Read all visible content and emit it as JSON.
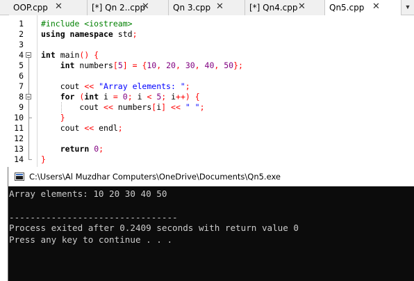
{
  "tabs": [
    {
      "label": "OOP.cpp",
      "active": false
    },
    {
      "label": "[*] Qn 2..cpp",
      "active": false
    },
    {
      "label": "Qn 3.cpp",
      "active": false
    },
    {
      "label": "[*] Qn4.cpp",
      "active": false
    },
    {
      "label": "Qn5.cpp",
      "active": true
    }
  ],
  "tab_close_glyph": "✕",
  "tab_scroll_glyph": "▼",
  "editor": {
    "line_numbers": [
      "1",
      "2",
      "3",
      "4",
      "5",
      "6",
      "7",
      "8",
      "9",
      "10",
      "11",
      "12",
      "13",
      "14"
    ],
    "lines": [
      [
        {
          "t": "#include <iostream>",
          "c": "pp"
        }
      ],
      [
        {
          "t": "using namespace",
          "c": "kw"
        },
        {
          "t": " std",
          "c": "plain"
        },
        {
          "t": ";",
          "c": "sym"
        }
      ],
      [],
      [
        {
          "t": "int",
          "c": "kw"
        },
        {
          "t": " main",
          "c": "plain"
        },
        {
          "t": "() {",
          "c": "sym"
        }
      ],
      [
        {
          "t": "    "
        },
        {
          "t": "int",
          "c": "kw"
        },
        {
          "t": " numbers",
          "c": "plain"
        },
        {
          "t": "[",
          "c": "sym"
        },
        {
          "t": "5",
          "c": "num"
        },
        {
          "t": "] = {",
          "c": "sym"
        },
        {
          "t": "10",
          "c": "num"
        },
        {
          "t": ", ",
          "c": "sym"
        },
        {
          "t": "20",
          "c": "num"
        },
        {
          "t": ", ",
          "c": "sym"
        },
        {
          "t": "30",
          "c": "num"
        },
        {
          "t": ", ",
          "c": "sym"
        },
        {
          "t": "40",
          "c": "num"
        },
        {
          "t": ", ",
          "c": "sym"
        },
        {
          "t": "50",
          "c": "num"
        },
        {
          "t": "};",
          "c": "sym"
        }
      ],
      [],
      [
        {
          "t": "    cout ",
          "c": "plain"
        },
        {
          "t": "<<",
          "c": "sym"
        },
        {
          "t": " ",
          "c": "plain"
        },
        {
          "t": "\"Array elements: \"",
          "c": "str"
        },
        {
          "t": ";",
          "c": "sym"
        }
      ],
      [
        {
          "t": "    "
        },
        {
          "t": "for",
          "c": "kw"
        },
        {
          "t": " (",
          "c": "sym"
        },
        {
          "t": "int",
          "c": "kw"
        },
        {
          "t": " i ",
          "c": "plain"
        },
        {
          "t": "=",
          "c": "sym"
        },
        {
          "t": " ",
          "c": "plain"
        },
        {
          "t": "0",
          "c": "num"
        },
        {
          "t": "; ",
          "c": "sym"
        },
        {
          "t": "i ",
          "c": "plain"
        },
        {
          "t": "<",
          "c": "sym"
        },
        {
          "t": " ",
          "c": "plain"
        },
        {
          "t": "5",
          "c": "num"
        },
        {
          "t": "; ",
          "c": "sym"
        },
        {
          "t": "i",
          "c": "plain"
        },
        {
          "t": "++) {",
          "c": "sym"
        }
      ],
      [
        {
          "t": "        cout ",
          "c": "plain"
        },
        {
          "t": "<<",
          "c": "sym"
        },
        {
          "t": " numbers",
          "c": "plain"
        },
        {
          "t": "[",
          "c": "sym"
        },
        {
          "t": "i",
          "c": "plain"
        },
        {
          "t": "]",
          "c": "sym"
        },
        {
          "t": " ",
          "c": "plain"
        },
        {
          "t": "<<",
          "c": "sym"
        },
        {
          "t": " ",
          "c": "plain"
        },
        {
          "t": "\" \"",
          "c": "str"
        },
        {
          "t": ";",
          "c": "sym"
        }
      ],
      [
        {
          "t": "    "
        },
        {
          "t": "}",
          "c": "sym"
        }
      ],
      [
        {
          "t": "    cout ",
          "c": "plain"
        },
        {
          "t": "<<",
          "c": "sym"
        },
        {
          "t": " endl",
          "c": "plain"
        },
        {
          "t": ";",
          "c": "sym"
        }
      ],
      [],
      [
        {
          "t": "    "
        },
        {
          "t": "return",
          "c": "kw"
        },
        {
          "t": " ",
          "c": "plain"
        },
        {
          "t": "0",
          "c": "num"
        },
        {
          "t": ";",
          "c": "sym"
        }
      ],
      [
        {
          "t": "}",
          "c": "sym"
        }
      ]
    ]
  },
  "console": {
    "title": "C:\\Users\\Al Muzdhar Computers\\OneDrive\\Documents\\Qn5.exe",
    "lines": [
      "Array elements: 10 20 30 40 50",
      "",
      "--------------------------------",
      "Process exited after 0.2409 seconds with return value 0",
      "Press any key to continue . . ."
    ]
  },
  "colors": {
    "keyword": "#000000",
    "preprocessor": "#008000",
    "symbol": "#ff0000",
    "number": "#800080",
    "string": "#0000ff",
    "console_bg": "#0c0c0c",
    "console_text": "#cccccc"
  }
}
